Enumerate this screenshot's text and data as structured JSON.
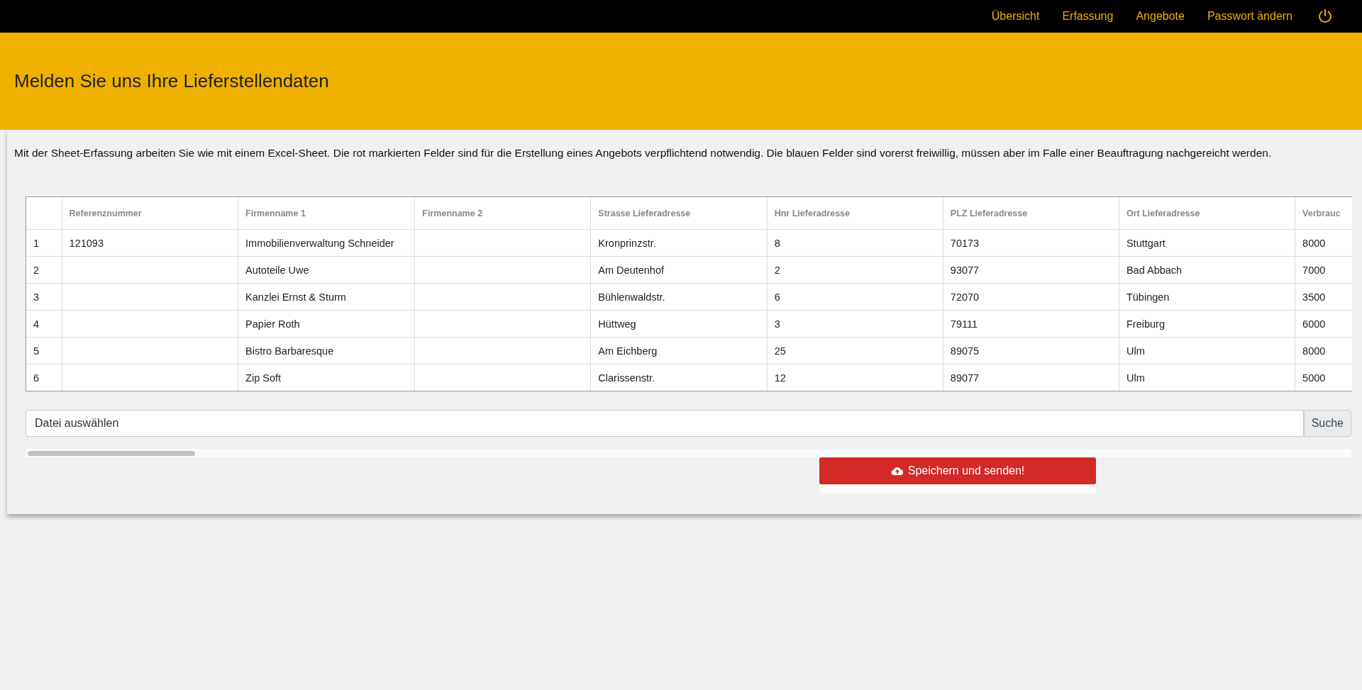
{
  "nav": {
    "items": [
      {
        "label": "Übersicht"
      },
      {
        "label": "Erfassung"
      },
      {
        "label": "Angebote"
      },
      {
        "label": "Passwort ändern"
      }
    ]
  },
  "header": {
    "title": "Melden Sie uns Ihre Lieferstellendaten"
  },
  "intro": "Mit der Sheet-Erfassung arbeiten Sie wie mit einem Excel-Sheet. Die rot markierten Felder sind für die Erstellung eines Angebots verpflichtend notwendig. Die blauen Felder sind vorerst freiwillig, müssen aber im Falle einer Beauftragung nachgereicht werden.",
  "table": {
    "columns": [
      "Referenznummer",
      "Firmenname 1",
      "Firmenname 2",
      "Strasse Lieferadresse",
      "Hnr Lieferadresse",
      "PLZ Lieferadresse",
      "Ort Lieferadresse",
      "Verbrauc"
    ],
    "rows": [
      {
        "number": "1",
        "cells": [
          "121093",
          "Immobilienverwaltung Schneider",
          null,
          "Kronprinzstr.",
          "8",
          "70173",
          "Stuttgart",
          "8000"
        ]
      },
      {
        "number": "2",
        "cells": [
          null,
          "Autoteile Uwe",
          null,
          "Am Deutenhof",
          "2",
          "93077",
          "Bad Abbach",
          "7000"
        ]
      },
      {
        "number": "3",
        "cells": [
          null,
          "Kanzlei Ernst & Sturm",
          null,
          "Bühlenwaldstr.",
          "6",
          "72070",
          "Tübingen",
          "3500"
        ]
      },
      {
        "number": "4",
        "cells": [
          null,
          "Papier Roth",
          null,
          "Hüttweg",
          "3",
          "79111",
          "Freiburg",
          "6000"
        ]
      },
      {
        "number": "5",
        "cells": [
          null,
          "Bistro Barbaresque",
          null,
          "Am Eichberg",
          "25",
          "89075",
          "Ulm",
          "8000"
        ]
      },
      {
        "number": "6",
        "cells": [
          null,
          "Zip Soft",
          null,
          "Clarissenstr.",
          "12",
          "89077",
          "Ulm",
          "5000"
        ]
      }
    ]
  },
  "file_input": {
    "placeholder": "Datei auswählen",
    "button": "Suche"
  },
  "submit_button": "Speichern und senden!"
}
